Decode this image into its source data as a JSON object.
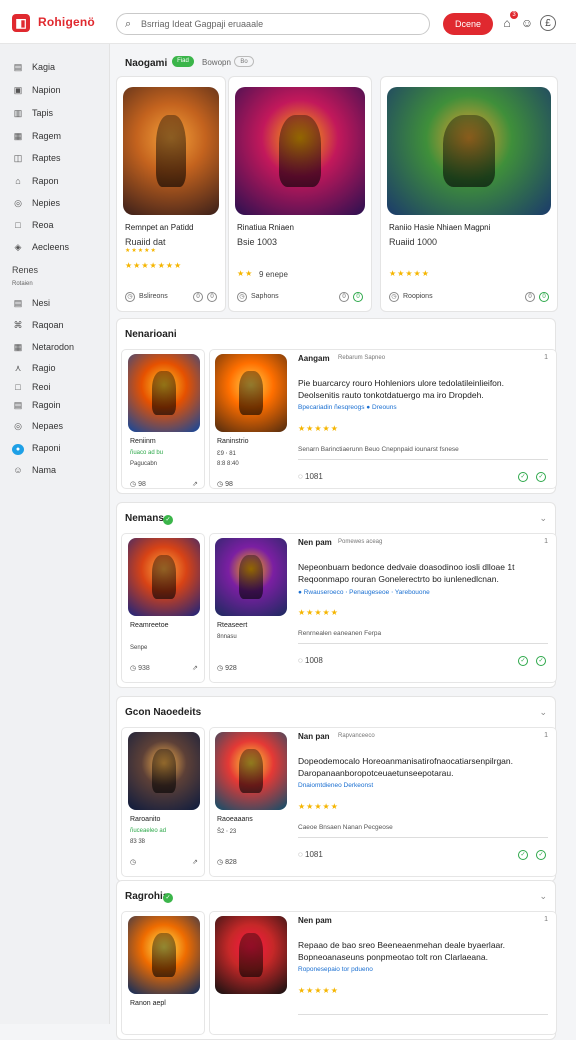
{
  "header": {
    "brand": "Rohigenö",
    "search_placeholder": "Bsrriag Ideat Gagpaji eruaaale",
    "cta": "Dcene",
    "notif_count": "3"
  },
  "sidebar": {
    "items": [
      {
        "label": "Kagia",
        "icon": "▤"
      },
      {
        "label": "Napion",
        "icon": "▣"
      },
      {
        "label": "Tapis",
        "icon": "▥"
      },
      {
        "label": "Ragem",
        "icon": "▦"
      },
      {
        "label": "Raptes",
        "icon": "◫"
      },
      {
        "label": "Rapon",
        "icon": "⌂"
      },
      {
        "label": "Nepies",
        "icon": "◎"
      },
      {
        "label": "Reoa",
        "icon": "□"
      },
      {
        "label": "Aecleens",
        "icon": "◈"
      }
    ],
    "section": "Renes",
    "subsection": "Rotaien",
    "items2": [
      {
        "label": "Nesi",
        "icon": "▤"
      },
      {
        "label": "Raqoan",
        "icon": "⌘"
      },
      {
        "label": "Netarodon",
        "icon": "▦"
      },
      {
        "label": "Ragio",
        "icon": "⋏"
      },
      {
        "label": "Reoi",
        "icon": "□"
      },
      {
        "label": "Ragoin",
        "icon": "▤"
      },
      {
        "label": "Nepaes",
        "icon": "◎"
      },
      {
        "label": "Raponi",
        "icon": "●"
      },
      {
        "label": "Nama",
        "icon": "☺"
      }
    ]
  },
  "featured": {
    "title": "Naogami",
    "badge": "Fiad",
    "subtitle": "Bowopn",
    "pill": "Bo",
    "cards": [
      {
        "name": "Remnpet an Patidd",
        "sub": "Ruaiid dat",
        "stars": "★★★★★",
        "rating_row": "★★★★★★★",
        "src": "Bslireons",
        "a": "0",
        "b": "0",
        "colors": [
          "#3a1f1a",
          "#c4631e",
          "#f4a23b"
        ]
      },
      {
        "name": "Rinatiua Rniaen",
        "sub": "Bsie 1003",
        "stars": "★★",
        "rating_row": "9 enepe",
        "src": "Saphons",
        "a": "0",
        "b": "0",
        "colors": [
          "#2a1050",
          "#c2185b",
          "#ffb300"
        ]
      },
      {
        "name": "Raniio Hasie Nhiaen Magpni",
        "sub": "Ruaiid 1000",
        "stars": "★★★★★",
        "rating_row": "",
        "src": "Roopions",
        "a": "0",
        "b": "0",
        "colors": [
          "#1b3a6b",
          "#3f8f3a",
          "#f0a030"
        ]
      }
    ]
  },
  "sections": [
    {
      "title": "Nenarioani",
      "small": {
        "name": "Reniinm",
        "green": "ñuaco ad bu",
        "desc": "Pagucabn",
        "foot": "98",
        "colors": [
          "#0d47a1",
          "#e65100",
          "#ffca28"
        ]
      },
      "detail": {
        "art_name": "Raninstrio",
        "g1": "Ɛ9 ⋅ 81",
        "g2": "8:8 8:40",
        "foot": "98",
        "title": "Aangam",
        "meta": "Rebarum Sapneo",
        "num": "1",
        "l1": "Pie buarcarcy rouro Hohleniors ulore tedolatileinlieifon.",
        "l2": "Deolsenitis rauto tonkotdatuergo ma iro Dropdeh.",
        "link": "Bpecariadin ñesqreogs ● Dreouns",
        "stars": "★★★★★",
        "foot_text": "Senarn Barinctiaerunn Beuo Cnepnpaid iounarst fsnese",
        "views": "1081",
        "colors": [
          "#4e2a0f",
          "#ff6f00",
          "#ffd54f"
        ]
      }
    },
    {
      "title": "Nemans",
      "small": {
        "name": "Reamreetoe",
        "green": "",
        "desc": "Senpe",
        "foot": "938",
        "colors": [
          "#1a237e",
          "#d84315",
          "#ffab40"
        ]
      },
      "detail": {
        "art_name": "Rteaseert",
        "g1": "8nnasu",
        "g2": "",
        "foot": "928",
        "title": "Nen pam",
        "meta": "Pomewes aceag",
        "num": "1",
        "l1": "Nepeonbuarn bedonce dedvaie doasodinoo iosli dlloae 1t",
        "l2": "Reqoonmapo rouran Gonelerectrto bo iunlenedlcnan.",
        "link": "● Rwauseroeco ⋅ Penaugeseoe ⋅ Yarebouone",
        "stars": "★★★★★",
        "foot_text": "Renrnealen eaneanen Ferpa",
        "views": "1008",
        "colors": [
          "#1b2a5e",
          "#7b1fa2",
          "#ffb300"
        ]
      }
    },
    {
      "title": "Gcon Naoedeits",
      "small": {
        "name": "Raroanito",
        "green": "ñuceaeleo ad",
        "desc": "8̈3 3̈8",
        "foot": "",
        "colors": [
          "#0d1b3e",
          "#5d4037",
          "#ffb74d"
        ]
      },
      "detail": {
        "art_name": "Raoeaaans",
        "g1": "Ŝ2 ⋅ 23",
        "g2": "",
        "foot": "828",
        "title": "Nan pan",
        "meta": "Rapvanceeco",
        "num": "1",
        "l1": "Dopeodemocalo Horeoanmanisatirofnaocatiarsenpilrgan.",
        "l2": "Daropanaanboropotceuaetunseepotarau.",
        "link": "Dnaiomtdieneo Derkeonst",
        "stars": "★★★★★",
        "foot_text": "Caeoe Bnsaen Nanan Pecgeose",
        "views": "1081",
        "colors": [
          "#0b4f6c",
          "#e53935",
          "#fdd835"
        ]
      }
    },
    {
      "title": "Ragrohia",
      "small": {
        "name": "Ranon aepl",
        "green": "",
        "desc": "",
        "foot": "",
        "colors": [
          "#0a2a5e",
          "#ef6c00",
          "#ffee58"
        ]
      },
      "detail": {
        "art_name": "",
        "g1": "",
        "g2": "",
        "foot": "",
        "title": "Nen pam",
        "meta": "",
        "num": "1",
        "l1": "Repaao de bao sreo Beeneaenmehan deale byaerlaar.",
        "l2": "Bopneoanaseuns ponpmeotao tolt ron Clarlaeana.",
        "link": "Roponesepaio tor pdueno",
        "stars": "★★★★★",
        "foot_text": "",
        "views": "",
        "colors": [
          "#111",
          "#c62828",
          "#ff1744"
        ]
      }
    }
  ]
}
